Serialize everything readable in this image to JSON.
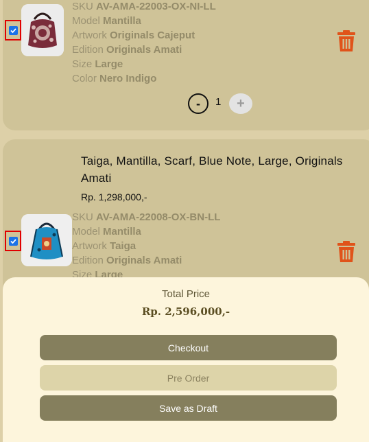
{
  "cart": {
    "items": [
      {
        "sku_label": "SKU",
        "sku": "AV-AMA-22003-OX-NI-LL",
        "model_label": "Model",
        "model": "Mantilla",
        "artwork_label": "Artwork",
        "artwork": "Originals Cajeput",
        "edition_label": "Edition",
        "edition": "Originals Amati",
        "size_label": "Size",
        "size": "Large",
        "color_label": "Color",
        "color": "Nero Indigo",
        "quantity": "1",
        "checked": true
      },
      {
        "title": "Taiga, Mantilla, Scarf, Blue Note, Large, Originals Amati",
        "price": "Rp. 1,298,000,-",
        "sku_label": "SKU",
        "sku": "AV-AMA-22008-OX-BN-LL",
        "model_label": "Model",
        "model": "Mantilla",
        "artwork_label": "Artwork",
        "artwork": "Taiga",
        "edition_label": "Edition",
        "edition": "Originals Amati",
        "size_label": "Size",
        "size": "Large",
        "checked": true
      }
    ],
    "minus_symbol": "-",
    "plus_symbol": "+"
  },
  "footer": {
    "total_label": "Total Price",
    "total_value": "Rp.  2,596,000,-",
    "checkout_label": "Checkout",
    "preorder_label": "Pre Order",
    "draft_label": "Save as Draft"
  },
  "icons": {
    "trash": "trash-icon",
    "checkbox": "checkbox-checked-icon"
  },
  "colors": {
    "background": "#ddd0a8",
    "card": "#cfc398",
    "footer": "#fdf5dc",
    "trash": "#e0531a",
    "checkbox": "#1a73e8",
    "highlight": "#e00000",
    "button_dark": "#857f5d",
    "button_light": "#ddd4a9"
  }
}
